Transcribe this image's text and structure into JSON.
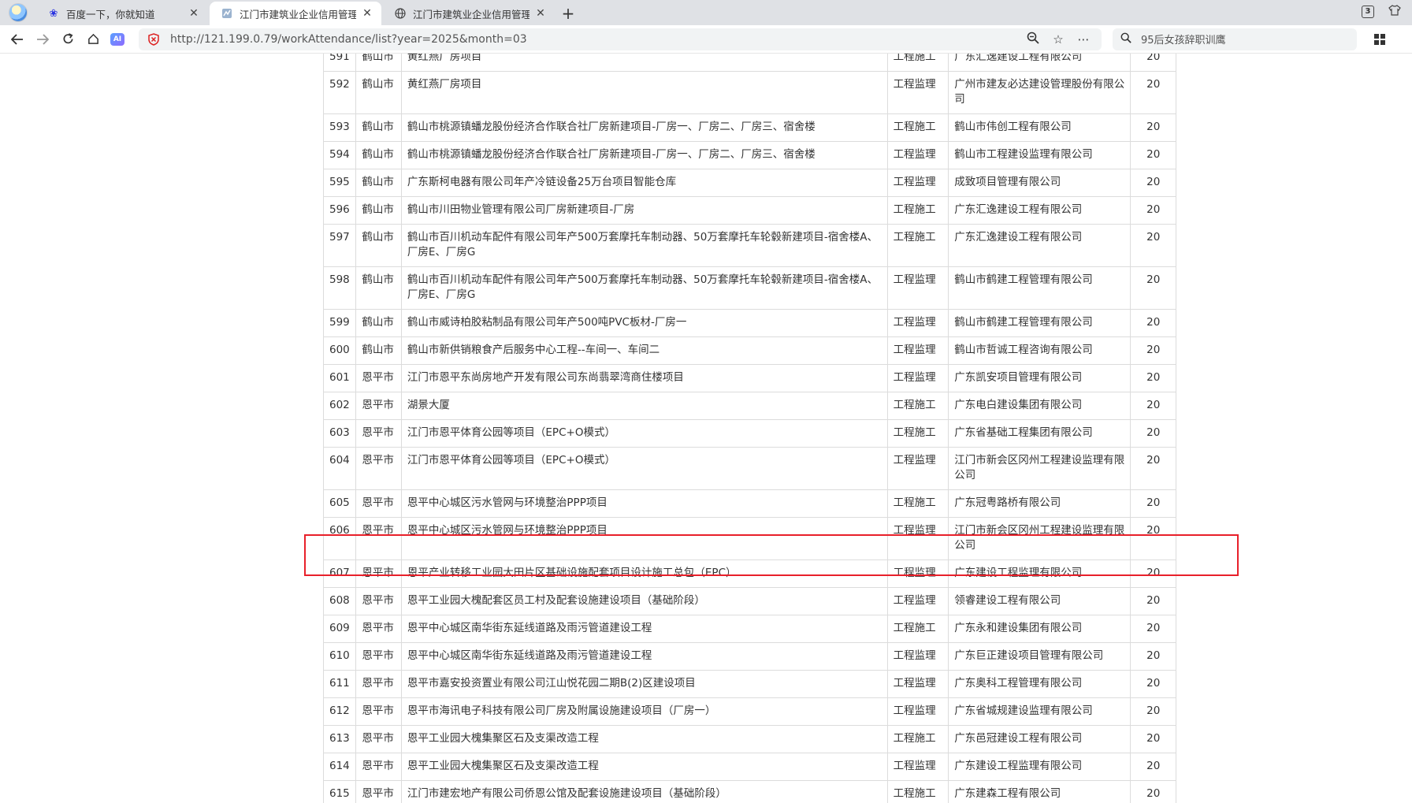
{
  "tabs": [
    {
      "title": "百度一下，你就知道",
      "favicon": "baidu-paw-icon",
      "active": false
    },
    {
      "title": "江门市建筑业企业信用管理信",
      "favicon": "site-icon",
      "active": true
    },
    {
      "title": "江门市建筑业企业信用管理信",
      "favicon": "globe-icon",
      "active": false
    }
  ],
  "window": {
    "tab_count": "3"
  },
  "toolbar": {
    "ai_label": "AI",
    "url": "http://121.199.0.79/workAttendance/list?year=2025&month=03",
    "search_value": "95后女孩辞职训鹰"
  },
  "colors": {
    "highlight": "#e8202a",
    "tab_strip": "#dfe1e5",
    "url_security": "#d22222"
  },
  "table": {
    "rows": [
      {
        "no": "591",
        "city": "鹤山市",
        "project": "黄红燕厂房项目",
        "type": "工程施工",
        "company": "广东汇逸建设工程有限公司",
        "count": "20"
      },
      {
        "no": "592",
        "city": "鹤山市",
        "project": "黄红燕厂房项目",
        "type": "工程监理",
        "company": "广州市建友必达建设管理股份有限公司",
        "count": "20"
      },
      {
        "no": "593",
        "city": "鹤山市",
        "project": "鹤山市桃源镇蟠龙股份经济合作联合社厂房新建项目-厂房一、厂房二、厂房三、宿舍楼",
        "type": "工程施工",
        "company": "鹤山市伟创工程有限公司",
        "count": "20"
      },
      {
        "no": "594",
        "city": "鹤山市",
        "project": "鹤山市桃源镇蟠龙股份经济合作联合社厂房新建项目-厂房一、厂房二、厂房三、宿舍楼",
        "type": "工程监理",
        "company": "鹤山市工程建设监理有限公司",
        "count": "20"
      },
      {
        "no": "595",
        "city": "鹤山市",
        "project": "广东斯柯电器有限公司年产冷链设备25万台项目智能仓库",
        "type": "工程监理",
        "company": "成致项目管理有限公司",
        "count": "20"
      },
      {
        "no": "596",
        "city": "鹤山市",
        "project": "鹤山市川田物业管理有限公司厂房新建项目-厂房",
        "type": "工程施工",
        "company": "广东汇逸建设工程有限公司",
        "count": "20"
      },
      {
        "no": "597",
        "city": "鹤山市",
        "project": "鹤山市百川机动车配件有限公司年产500万套摩托车制动器、50万套摩托车轮毂新建项目-宿舍楼A、厂房E、厂房G",
        "type": "工程施工",
        "company": "广东汇逸建设工程有限公司",
        "count": "20"
      },
      {
        "no": "598",
        "city": "鹤山市",
        "project": "鹤山市百川机动车配件有限公司年产500万套摩托车制动器、50万套摩托车轮毂新建项目-宿舍楼A、厂房E、厂房G",
        "type": "工程监理",
        "company": "鹤山市鹤建工程管理有限公司",
        "count": "20"
      },
      {
        "no": "599",
        "city": "鹤山市",
        "project": "鹤山市威诗柏胶粘制品有限公司年产500吨PVC板材-厂房一",
        "type": "工程监理",
        "company": "鹤山市鹤建工程管理有限公司",
        "count": "20"
      },
      {
        "no": "600",
        "city": "鹤山市",
        "project": "鹤山市新供销粮食产后服务中心工程--车间一、车间二",
        "type": "工程监理",
        "company": "鹤山市哲诚工程咨询有限公司",
        "count": "20"
      },
      {
        "no": "601",
        "city": "恩平市",
        "project": "江门市恩平东尚房地产开发有限公司东尚翡翠湾商住楼项目",
        "type": "工程监理",
        "company": "广东凯安项目管理有限公司",
        "count": "20"
      },
      {
        "no": "602",
        "city": "恩平市",
        "project": "湖景大厦",
        "type": "工程施工",
        "company": "广东电白建设集团有限公司",
        "count": "20"
      },
      {
        "no": "603",
        "city": "恩平市",
        "project": "江门市恩平体育公园等项目（EPC+O模式）",
        "type": "工程施工",
        "company": "广东省基础工程集团有限公司",
        "count": "20"
      },
      {
        "no": "604",
        "city": "恩平市",
        "project": "江门市恩平体育公园等项目（EPC+O模式）",
        "type": "工程监理",
        "company": "江门市新会区冈州工程建设监理有限公司",
        "count": "20"
      },
      {
        "no": "605",
        "city": "恩平市",
        "project": "恩平中心城区污水管网与环境整治PPP项目",
        "type": "工程施工",
        "company": "广东冠粤路桥有限公司",
        "count": "20"
      },
      {
        "no": "606",
        "city": "恩平市",
        "project": "恩平中心城区污水管网与环境整治PPP项目",
        "type": "工程监理",
        "company": "江门市新会区冈州工程建设监理有限公司",
        "count": "20"
      },
      {
        "no": "607",
        "city": "恩平市",
        "project": "恩平产业转移工业园大田片区基础设施配套项目设计施工总包（EPC）",
        "type": "工程监理",
        "company": "广东建设工程监理有限公司",
        "count": "20"
      },
      {
        "no": "608",
        "city": "恩平市",
        "project": "恩平工业园大槐配套区员工村及配套设施建设项目（基础阶段）",
        "type": "工程监理",
        "company": "领睿建设工程有限公司",
        "count": "20"
      },
      {
        "no": "609",
        "city": "恩平市",
        "project": "恩平中心城区南华街东延线道路及雨污管道建设工程",
        "type": "工程施工",
        "company": "广东永和建设集团有限公司",
        "count": "20"
      },
      {
        "no": "610",
        "city": "恩平市",
        "project": "恩平中心城区南华街东延线道路及雨污管道建设工程",
        "type": "工程监理",
        "company": "广东巨正建设项目管理有限公司",
        "count": "20"
      },
      {
        "no": "611",
        "city": "恩平市",
        "project": "恩平市嘉安投资置业有限公司江山悦花园二期B(2)区建设项目",
        "type": "工程监理",
        "company": "广东奥科工程管理有限公司",
        "count": "20"
      },
      {
        "no": "612",
        "city": "恩平市",
        "project": "恩平市海讯电子科技有限公司厂房及附属设施建设项目（厂房一）",
        "type": "工程监理",
        "company": "广东省城规建设监理有限公司",
        "count": "20"
      },
      {
        "no": "613",
        "city": "恩平市",
        "project": "恩平工业园大槐集聚区石及支渠改造工程",
        "type": "工程施工",
        "company": "广东邑冠建设工程有限公司",
        "count": "20"
      },
      {
        "no": "614",
        "city": "恩平市",
        "project": "恩平工业园大槐集聚区石及支渠改造工程",
        "type": "工程监理",
        "company": "广东建设工程监理有限公司",
        "count": "20"
      },
      {
        "no": "615",
        "city": "恩平市",
        "project": "江门市建宏地产有限公司侨恩公馆及配套设施建设项目（基础阶段）",
        "type": "工程施工",
        "company": "广东建森工程有限公司",
        "count": "20"
      }
    ]
  }
}
